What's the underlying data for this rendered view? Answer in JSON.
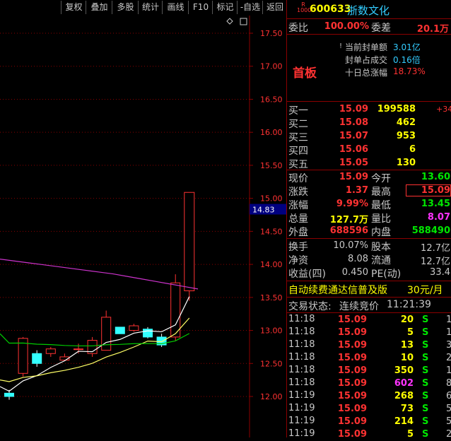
{
  "toolbar": {
    "buttons": [
      "复权",
      "叠加",
      "多股",
      "统计",
      "画线",
      "F10",
      "标记",
      "-自选",
      "返回"
    ]
  },
  "chart": {
    "price_ticks": [
      "17.50",
      "17.00",
      "16.50",
      "16.00",
      "15.50",
      "15.00",
      "14.50",
      "14.00",
      "13.50",
      "13.00",
      "12.50",
      "12.00"
    ],
    "current_price_tag": "14.83"
  },
  "stock": {
    "badge_top": "R",
    "badge_bottom": "1000",
    "code": "600633",
    "name": "浙数文化"
  },
  "weibi": {
    "label": "委比",
    "value": "100.00%",
    "diff_label": "委差",
    "diff_value": "20.1万"
  },
  "seal": {
    "marker": "!",
    "amount_label": "当前封单额",
    "amount_value": "3.01亿",
    "ratio_label": "封单占成交",
    "ratio_value": "0.16倍",
    "tenday_label": "十日总涨幅",
    "tenday_value": "18.73%",
    "board_label": "首板"
  },
  "bids": [
    {
      "label": "买一",
      "price": "15.09",
      "vol": "199588",
      "extra": "+34"
    },
    {
      "label": "买二",
      "price": "15.08",
      "vol": "462",
      "extra": ""
    },
    {
      "label": "买三",
      "price": "15.07",
      "vol": "953",
      "extra": ""
    },
    {
      "label": "买四",
      "price": "15.06",
      "vol": "6",
      "extra": ""
    },
    {
      "label": "买五",
      "price": "15.05",
      "vol": "130",
      "extra": ""
    }
  ],
  "quote": {
    "now_label": "现价",
    "now": "15.09",
    "open_label": "今开",
    "open": "13.60",
    "chg_label": "涨跌",
    "chg": "1.37",
    "high_label": "最高",
    "high": "15.09",
    "pct_label": "涨幅",
    "pct": "9.99%",
    "low_label": "最低",
    "low": "13.45",
    "vol_label": "总量",
    "vol": "127.7万",
    "vr_label": "量比",
    "vr": "8.07",
    "out_label": "外盘",
    "out": "688596",
    "in_label": "内盘",
    "in": "588490"
  },
  "fin": {
    "turnover_label": "换手",
    "turnover": "10.07%",
    "cap_label": "股本",
    "cap": "12.7亿",
    "nav_label": "净资",
    "nav": "8.08",
    "float_label": "流通",
    "float": "12.7亿",
    "eps_label": "收益(四)",
    "eps": "0.450",
    "pe_label": "PE(动)",
    "pe": "33.4"
  },
  "ad": {
    "text": "自动续费通达信普及版",
    "price": "30元/月"
  },
  "status": {
    "label": "交易状态:",
    "state": "连续竞价",
    "time": "11:21:39"
  },
  "ticks": [
    {
      "time": "11:18",
      "price": "15.09",
      "vol": "20",
      "side": "S",
      "n": "1",
      "volColor": "yellow"
    },
    {
      "time": "11:18",
      "price": "15.09",
      "vol": "5",
      "side": "S",
      "n": "1",
      "volColor": "yellow"
    },
    {
      "time": "11:18",
      "price": "15.09",
      "vol": "13",
      "side": "S",
      "n": "3",
      "volColor": "yellow"
    },
    {
      "time": "11:18",
      "price": "15.09",
      "vol": "10",
      "side": "S",
      "n": "2",
      "volColor": "yellow"
    },
    {
      "time": "11:18",
      "price": "15.09",
      "vol": "350",
      "side": "S",
      "n": "1",
      "volColor": "yellow"
    },
    {
      "time": "11:18",
      "price": "15.09",
      "vol": "602",
      "side": "S",
      "n": "8",
      "volColor": "magenta"
    },
    {
      "time": "11:19",
      "price": "15.09",
      "vol": "268",
      "side": "S",
      "n": "6",
      "volColor": "yellow"
    },
    {
      "time": "11:19",
      "price": "15.09",
      "vol": "73",
      "side": "S",
      "n": "5",
      "volColor": "yellow"
    },
    {
      "time": "11:19",
      "price": "15.09",
      "vol": "214",
      "side": "S",
      "n": "5",
      "volColor": "yellow"
    },
    {
      "time": "11:19",
      "price": "15.09",
      "vol": "5",
      "side": "S",
      "n": "2",
      "volColor": "yellow"
    }
  ],
  "colors": {
    "up": "#ff3232",
    "down": "#33ffff",
    "ma5": "#ffffff",
    "ma10": "#ffff66",
    "ma20": "#00cc00",
    "ma60": "#cc33cc",
    "grid": "#8b0000"
  },
  "candles": [
    {
      "o": 12.05,
      "h": 12.1,
      "l": 11.95,
      "c": 12.0
    },
    {
      "o": 12.35,
      "h": 12.9,
      "l": 12.3,
      "c": 12.88
    },
    {
      "o": 12.65,
      "h": 12.7,
      "l": 12.45,
      "c": 12.5
    },
    {
      "o": 12.65,
      "h": 12.75,
      "l": 12.6,
      "c": 12.72
    },
    {
      "o": 12.55,
      "h": 12.65,
      "l": 12.55,
      "c": 12.6
    },
    {
      "o": 12.72,
      "h": 12.8,
      "l": 12.65,
      "c": 12.72
    },
    {
      "o": 12.65,
      "h": 12.9,
      "l": 12.6,
      "c": 12.85
    },
    {
      "o": 12.7,
      "h": 13.3,
      "l": 12.7,
      "c": 13.2
    },
    {
      "o": 13.05,
      "h": 13.05,
      "l": 12.95,
      "c": 12.95
    },
    {
      "o": 13.0,
      "h": 13.1,
      "l": 12.98,
      "c": 13.07
    },
    {
      "o": 13.02,
      "h": 13.05,
      "l": 12.88,
      "c": 12.9
    },
    {
      "o": 12.9,
      "h": 12.95,
      "l": 12.75,
      "c": 12.78
    },
    {
      "o": 12.9,
      "h": 13.85,
      "l": 12.85,
      "c": 13.72
    },
    {
      "o": 13.6,
      "h": 15.09,
      "l": 13.45,
      "c": 15.09
    }
  ]
}
